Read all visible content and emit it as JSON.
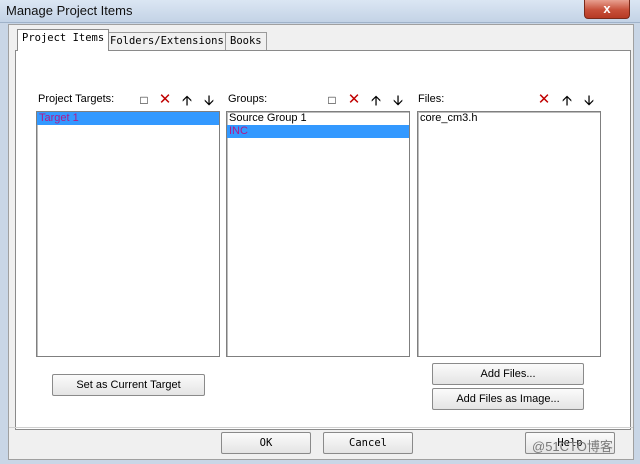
{
  "window": {
    "title": "Manage Project Items",
    "close": "x"
  },
  "tabs": [
    {
      "label": "Project Items"
    },
    {
      "label": "Folders/Extensions"
    },
    {
      "label": "Books"
    }
  ],
  "targets": {
    "label": "Project Targets:",
    "items": [
      "Target 1"
    ],
    "selected": "Target 1",
    "set_current_label": "Set as Current Target"
  },
  "groups": {
    "label": "Groups:",
    "items": [
      "Source Group 1",
      "INC"
    ],
    "selected": "INC"
  },
  "files": {
    "label": "Files:",
    "items": [
      "core_cm3.h"
    ],
    "add_files_label": "Add Files...",
    "add_image_label": "Add Files as Image..."
  },
  "footer": {
    "ok_label": "OK",
    "cancel_label": "Cancel",
    "help_label": "Help"
  },
  "watermark": "@51CTO博客",
  "colors": {
    "selection": "#3399ff",
    "selected_text": "#b01a8a",
    "delete_icon": "#c00000"
  }
}
